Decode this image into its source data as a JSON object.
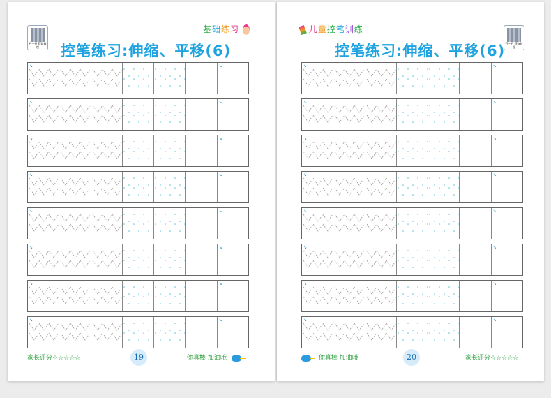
{
  "title": "控笔练习:伸缩、平移(6)",
  "qr_caption": "扫一扫 获取教程",
  "left_page": {
    "corner_label": "基础练习",
    "page_number": "19",
    "rating_label": "家长评分",
    "stars": "☆☆☆☆☆",
    "praise": "你真棒 加油哦"
  },
  "right_page": {
    "corner_label": "儿童控笔训练",
    "page_number": "20",
    "rating_label": "家长评分",
    "stars": "☆☆☆☆☆",
    "praise": "你真棒 加油哦"
  },
  "worksheet": {
    "rows": 8,
    "cells_per_row": 7,
    "row_style_per_page": [
      "zigzag",
      "zigzag",
      "zigzag",
      "zigzag",
      "zigzag",
      "zigzag",
      "zigzag",
      "zigzag"
    ],
    "cell_modes": [
      "trace",
      "trace",
      "trace",
      "dots",
      "dots",
      "blank",
      "blank"
    ]
  },
  "colors": {
    "title": "#1fa3e0",
    "trace_line": "#9e9e9e",
    "dots": "#5fbfdc",
    "footer_text": "#3aa34a",
    "corner_left": [
      "#2fae4d",
      "#1fa3e0",
      "#f29a1f",
      "#e8388a"
    ],
    "corner_right": [
      "#e8388a",
      "#f29a1f",
      "#2fae4d",
      "#1fa3e0",
      "#9a4fd6",
      "#2fae4d"
    ]
  },
  "icons": [
    "qr-code-icon",
    "girl-icon",
    "pencil-icon",
    "bird-icon",
    "page-number-badge"
  ]
}
